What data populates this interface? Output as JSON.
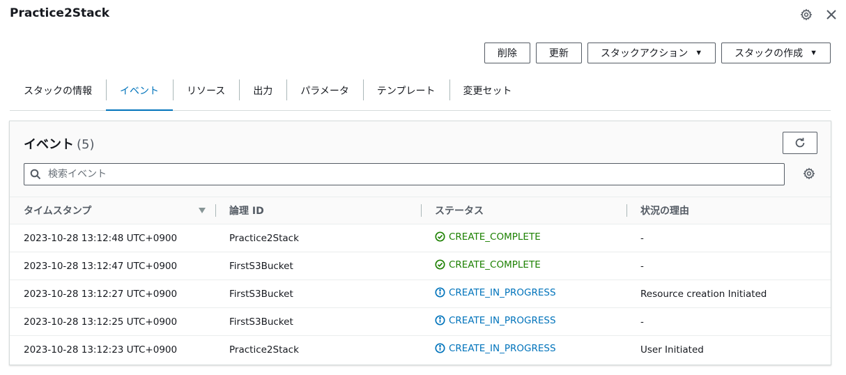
{
  "header": {
    "title": "Practice2Stack"
  },
  "top_icons": [
    "settings-icon",
    "close-icon"
  ],
  "actions": {
    "delete": "削除",
    "update": "更新",
    "stack_actions": "スタックアクション",
    "create_stack": "スタックの作成"
  },
  "tabs": [
    {
      "label": "スタックの情報",
      "active": false
    },
    {
      "label": "イベント",
      "active": true
    },
    {
      "label": "リソース",
      "active": false
    },
    {
      "label": "出力",
      "active": false
    },
    {
      "label": "パラメータ",
      "active": false
    },
    {
      "label": "テンプレート",
      "active": false
    },
    {
      "label": "変更セット",
      "active": false
    }
  ],
  "events": {
    "title": "イベント",
    "count": "(5)",
    "search_placeholder": "検索イベント",
    "columns": [
      "タイムスタンプ",
      "論理 ID",
      "ステータス",
      "状況の理由"
    ],
    "rows": [
      {
        "timestamp": "2023-10-28 13:12:48 UTC+0900",
        "logical_id": "Practice2Stack",
        "status": "CREATE_COMPLETE",
        "status_type": "ok",
        "reason": "-"
      },
      {
        "timestamp": "2023-10-28 13:12:47 UTC+0900",
        "logical_id": "FirstS3Bucket",
        "status": "CREATE_COMPLETE",
        "status_type": "ok",
        "reason": "-"
      },
      {
        "timestamp": "2023-10-28 13:12:27 UTC+0900",
        "logical_id": "FirstS3Bucket",
        "status": "CREATE_IN_PROGRESS",
        "status_type": "progress",
        "reason": "Resource creation Initiated"
      },
      {
        "timestamp": "2023-10-28 13:12:25 UTC+0900",
        "logical_id": "FirstS3Bucket",
        "status": "CREATE_IN_PROGRESS",
        "status_type": "progress",
        "reason": "-"
      },
      {
        "timestamp": "2023-10-28 13:12:23 UTC+0900",
        "logical_id": "Practice2Stack",
        "status": "CREATE_IN_PROGRESS",
        "status_type": "progress",
        "reason": "User Initiated"
      }
    ]
  },
  "colors": {
    "accent": "#0073bb",
    "success": "#1d8102",
    "text": "#16191f",
    "muted": "#545b64"
  }
}
